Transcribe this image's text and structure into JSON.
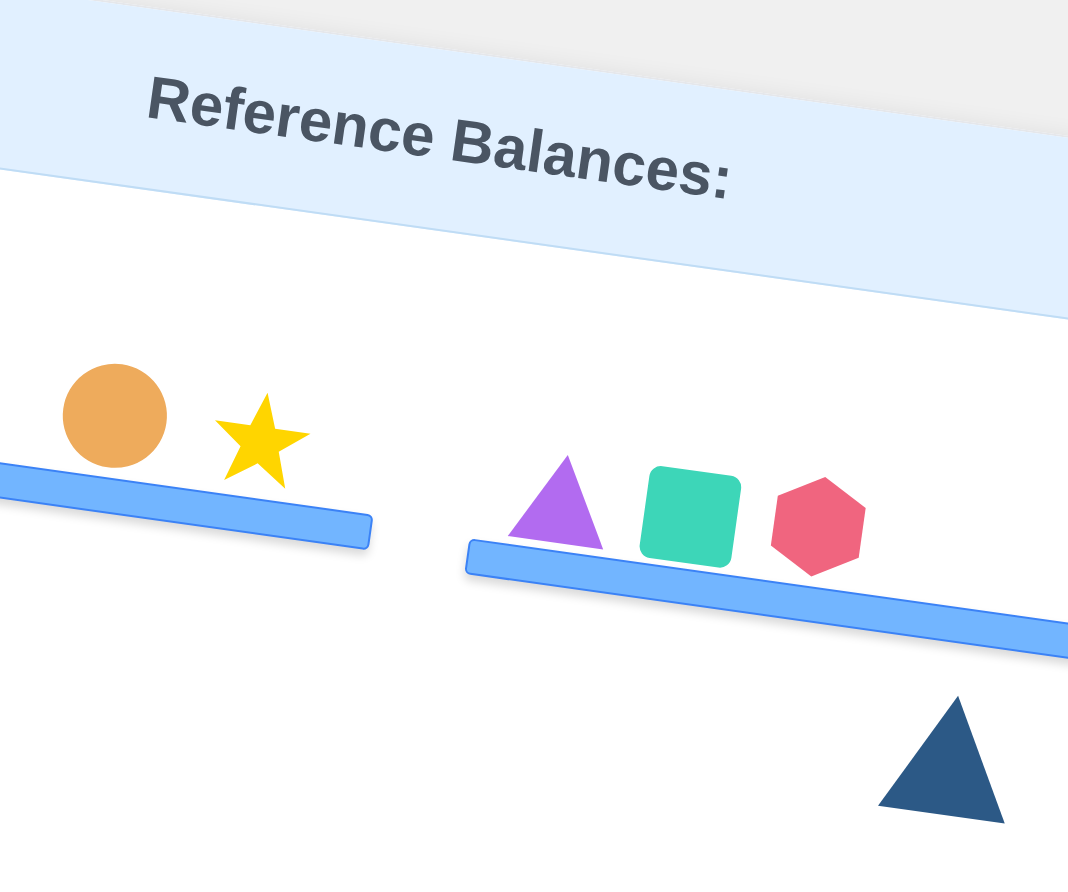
{
  "title": "Reference Balances:",
  "balances": [
    {
      "items": [
        {
          "kind": "circle",
          "color": "#eeab5c"
        },
        {
          "kind": "star",
          "color": "#ffd500"
        }
      ]
    },
    {
      "items": [
        {
          "kind": "triangle",
          "color": "#b26bf0"
        },
        {
          "kind": "square",
          "color": "#3dd6b8"
        },
        {
          "kind": "hexagon",
          "color": "#f0657f"
        }
      ]
    }
  ]
}
